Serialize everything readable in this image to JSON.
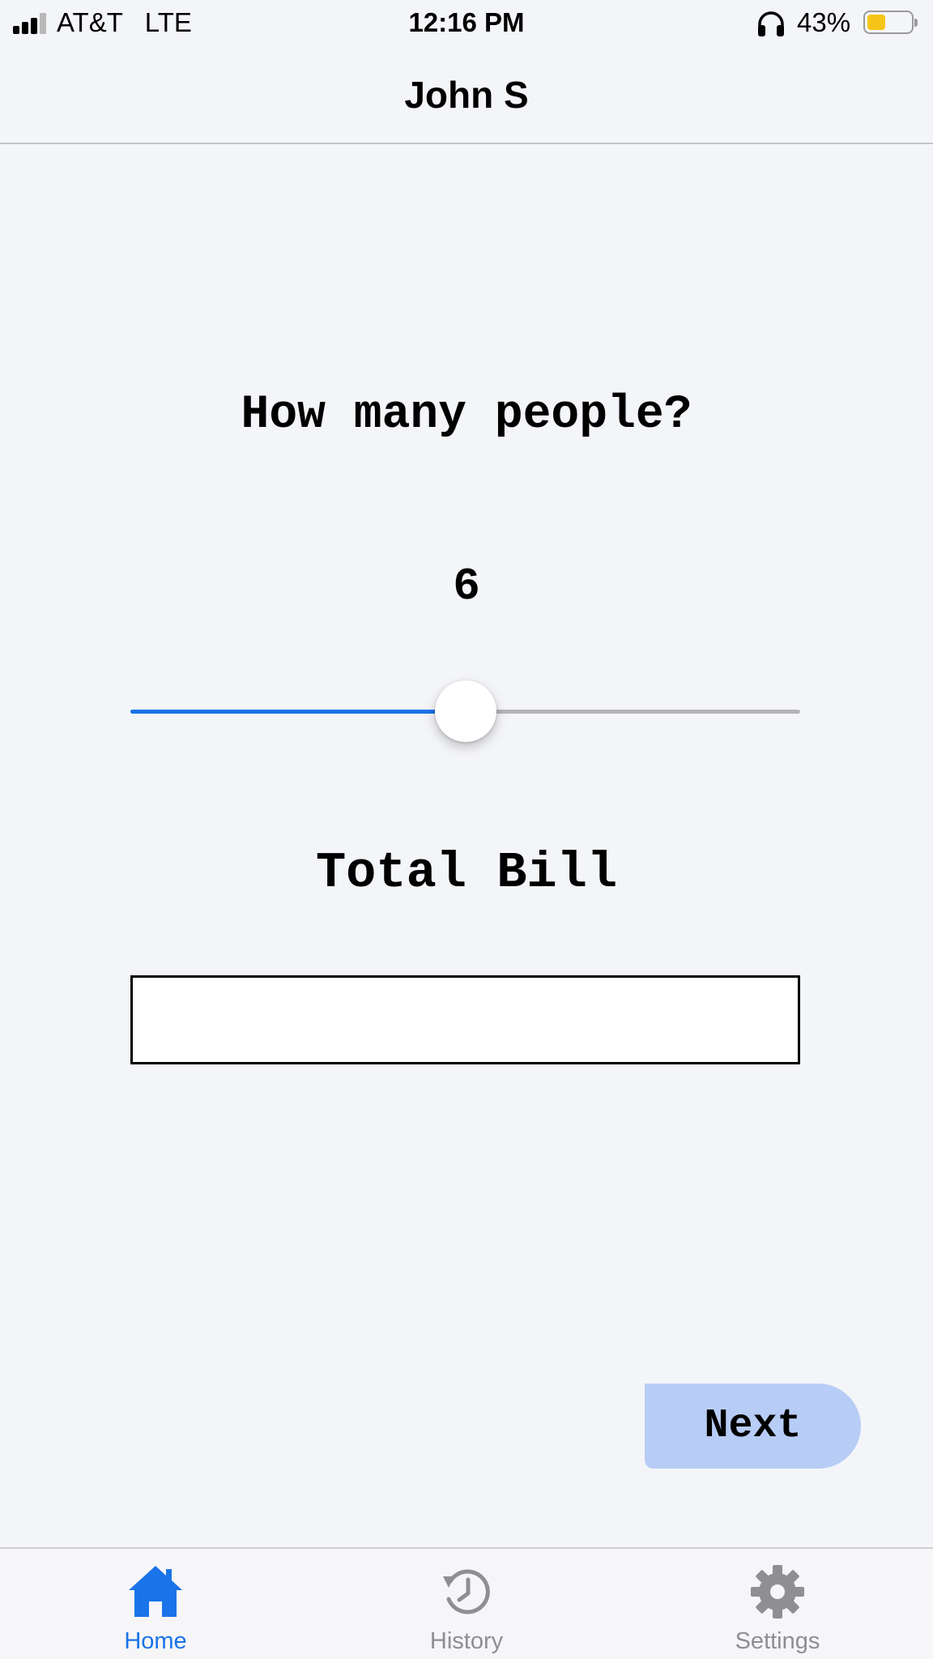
{
  "status_bar": {
    "carrier": "AT&T   LTE",
    "time": "12:16 PM",
    "battery_percent": "43%",
    "battery_level": 0.43,
    "signal_bars": 3,
    "signal_max": 4,
    "icons": [
      "signal-icon",
      "headphones-icon",
      "battery-icon"
    ]
  },
  "header": {
    "title": "John S"
  },
  "main": {
    "question": "How many people?",
    "people_count": "6",
    "slider": {
      "value": 6,
      "fraction": 0.5
    },
    "total_label": "Total Bill",
    "bill_input": {
      "value": "",
      "placeholder": ""
    },
    "next_label": "Next"
  },
  "tab_bar": {
    "active_index": 0,
    "items": [
      {
        "label": "Home",
        "icon": "home-icon"
      },
      {
        "label": "History",
        "icon": "history-icon"
      },
      {
        "label": "Settings",
        "icon": "settings-icon"
      }
    ]
  },
  "colors": {
    "background": "#f4f5f9",
    "accent": "#1a73e8",
    "tab_active": "#1a73e8",
    "tab_inactive": "#8e8e93",
    "next_button": "#b8cdf5",
    "slider_track": "#b4b4b4",
    "battery_fill": "#f5c518"
  }
}
